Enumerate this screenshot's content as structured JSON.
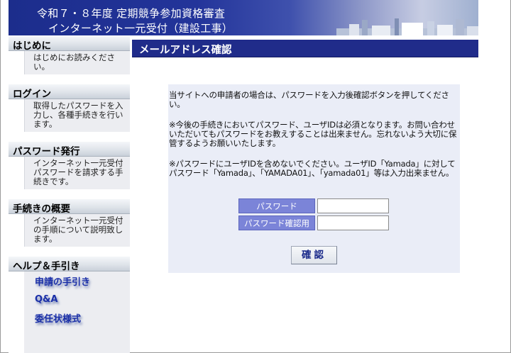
{
  "header": {
    "line1": "令和７・８年度 定期競争参加資格審査",
    "line2": "インターネット一元受付（建設工事）"
  },
  "sidebar": {
    "sections": [
      {
        "title": "はじめに",
        "body": "はじめにお読みください。"
      },
      {
        "title": "ログイン",
        "body": "取得したパスワードを入力し、各種手続きを行います。"
      },
      {
        "title": "パスワード発行",
        "body": "インターネット一元受付パスワードを請求する手続きです。"
      },
      {
        "title": "手続きの概要",
        "body": "インターネット一元受付の手順について説明致します。"
      }
    ],
    "help": {
      "title": "ヘルプ＆手引き",
      "links": [
        "申請の手引き",
        "Q&A",
        "委任状様式"
      ]
    }
  },
  "main": {
    "title": "メールアドレス確認",
    "paragraphs": [
      "当サイトへの申請者の場合は、パスワードを入力後確認ボタンを押してください。",
      "※今後の手続きにおいてパスワード、ユーザIDは必須となります。お問い合わせいただいてもパスワードをお教えすることは出来ません。忘れないよう大切に保管するようお願いいたします。",
      "※パスワードにユーザIDを含めないでください。ユーザID「Yamada」に対してパスワード「Yamada」、「YAMADA01」、「yamada01」等は入力出来ません。"
    ],
    "form": {
      "password_label": "パスワード",
      "password_value": "",
      "confirm_label": "パスワード確認用",
      "confirm_value": ""
    },
    "confirm_button": "確認"
  },
  "colors": {
    "header_dark": "#1c2d8c",
    "title_bar": "#202c8a",
    "form_label_bg": "#7b84d8",
    "content_bg": "#eaedf7",
    "link": "#1a2fa8"
  }
}
